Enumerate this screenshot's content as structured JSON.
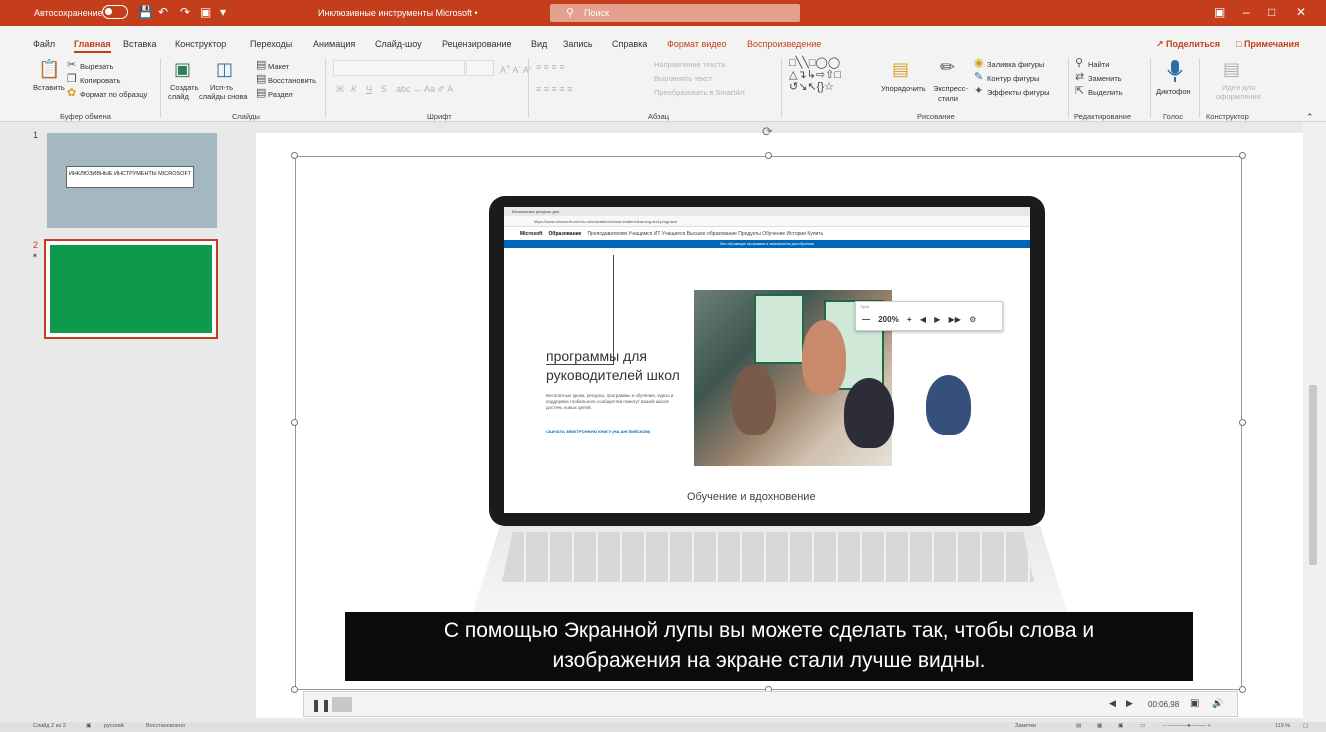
{
  "titlebar": {
    "autosave_label": "Автосохранение",
    "doc_title": "Инклюзивные инструменты Microsoft •",
    "search_placeholder": "Поиск",
    "bg": "#c43e1c"
  },
  "tabs": [
    {
      "label": "Файл"
    },
    {
      "label": "Главная"
    },
    {
      "label": "Вставка"
    },
    {
      "label": "Конструктор"
    },
    {
      "label": "Переходы"
    },
    {
      "label": "Анимация"
    },
    {
      "label": "Слайд-шоу"
    },
    {
      "label": "Рецензирование"
    },
    {
      "label": "Вид"
    },
    {
      "label": "Запись"
    },
    {
      "label": "Справка"
    },
    {
      "label": "Формат видео"
    },
    {
      "label": "Воспроизведение"
    }
  ],
  "share_label": "Поделиться",
  "notes_label": "Примечания",
  "ribbon": {
    "clipboard": {
      "paste": "Вставить",
      "cut": "Вырезать",
      "copy": "Копировать",
      "format": "Формат по образцу",
      "group": "Буфер обмена"
    },
    "slides": {
      "create": "Создать",
      "create2": "слайд",
      "reuse": "Исп-ть",
      "reuse2": "слайды снова",
      "layout": "Макет",
      "reset": "Восстановить",
      "section": "Раздел",
      "group": "Слайды"
    },
    "font": {
      "bold": "Ж",
      "italic": "К",
      "underline": "Ч",
      "strike": "S",
      "group": "Шрифт"
    },
    "paragraph": {
      "direction": "Направление текста",
      "align": "Выровнять текст",
      "smartart": "Преобразовать в SmartArt",
      "group": "Абзац"
    },
    "drawing": {
      "arrange": "Упорядочить",
      "quickstyles": "Экспресс-",
      "quickstyles2": "стили",
      "fill": "Заливка фигуры",
      "outline": "Контур фигуры",
      "effects": "Эффекты фигуры",
      "group": "Рисование"
    },
    "editing": {
      "find": "Найти",
      "replace": "Заменить",
      "select": "Выделить",
      "group": "Редактирование"
    },
    "voice": {
      "dictate": "Диктофон",
      "group": "Голос"
    },
    "designer": {
      "ideas": "Идеи для",
      "ideas2": "оформления",
      "group": "Конструктор"
    }
  },
  "slides": [
    {
      "number": "1",
      "thumb_text": "ИНКЛЮЗИВНЫЕ ИНСТРУМЕНТЫ MICROSOFT",
      "bg": "#a3b8c0"
    },
    {
      "number": "2",
      "bg": "#0e9a4d"
    }
  ],
  "video": {
    "browser_tab": "Бесплатные ресурсы для",
    "url": "https://www.microsoft.com/ru-ru/education/school-leaders/learning-and-programs",
    "nav_brand": "Microsoft",
    "nav_section": "Образование",
    "nav_items": "Преподавателям  Учащимся  ИТ  Учащиеся  Высшее образование  Продукты  Обучение  Истории  Купить",
    "banner": "Все обучающие программы и мероприятия для обучения",
    "heading_line1": "программы для",
    "heading_line2": "руководителей школ",
    "body": "Бесплатные уроки, ресурсы, программы и обучение, курсы и поддержка глобального сообщества помогут вашей школе достичь новых целей.",
    "link": "СКАЧАТЬ ЭЛЕКТРОННУЮ КНИГУ (НА АНГЛИЙСКОМ)",
    "magnifier_title": "Лупа",
    "magnifier_zoom": "200%",
    "subheading": "Обучение и вдохновение",
    "caption_line1": "С помощью Экранной лупы вы можете сделать так, чтобы слова и",
    "caption_line2": "изображения на экране стали лучше видны."
  },
  "media": {
    "time": "00:06,98",
    "progress": 0.02
  },
  "statusbar": {
    "slide": "Слайд 2 из 2",
    "lang": "русский",
    "recovery": "Восстановлено",
    "notes": "Заметки",
    "zoom": "119 %"
  }
}
